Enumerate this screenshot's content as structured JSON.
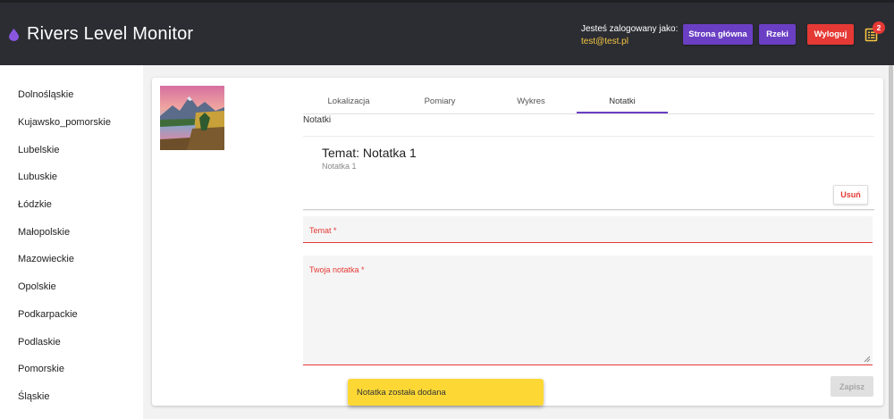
{
  "header": {
    "title": "Rivers Level Monitor",
    "login_label": "Jesteś zalogowany jako:",
    "login_email": "test@test.pl",
    "home_button": "Strona główna",
    "rivers_button": "Rzeki",
    "logout_button": "Wyloguj",
    "notification_count": "2",
    "icons": {
      "brand": "water-drop-icon",
      "notifications": "notes-list-icon"
    },
    "colors": {
      "primary": "#6a3fc4",
      "danger": "#e53935",
      "accent": "#f5c542"
    }
  },
  "sidebar": {
    "items": [
      {
        "label": "Dolnośląskie"
      },
      {
        "label": "Kujawsko_pomorskie"
      },
      {
        "label": "Lubelskie"
      },
      {
        "label": "Lubuskie"
      },
      {
        "label": "Łódzkie"
      },
      {
        "label": "Małopolskie"
      },
      {
        "label": "Mazowieckie"
      },
      {
        "label": "Opolskie"
      },
      {
        "label": "Podkarpackie"
      },
      {
        "label": "Podlaskie"
      },
      {
        "label": "Pomorskie"
      },
      {
        "label": "Śląskie"
      }
    ]
  },
  "main": {
    "tabs": [
      {
        "label": "Lokalizacja"
      },
      {
        "label": "Pomiary"
      },
      {
        "label": "Wykres"
      },
      {
        "label": "Notatki"
      }
    ],
    "active_tab": "Notatki",
    "section_label": "Notatki",
    "note": {
      "title": "Temat: Notatka 1",
      "body": "Notatka 1",
      "delete_button": "Usuń"
    },
    "form": {
      "subject_label": "Temat *",
      "note_label": "Twoja notatka *",
      "save_button": "Zapisz"
    }
  },
  "toast": {
    "message": "Notatka została dodana"
  }
}
